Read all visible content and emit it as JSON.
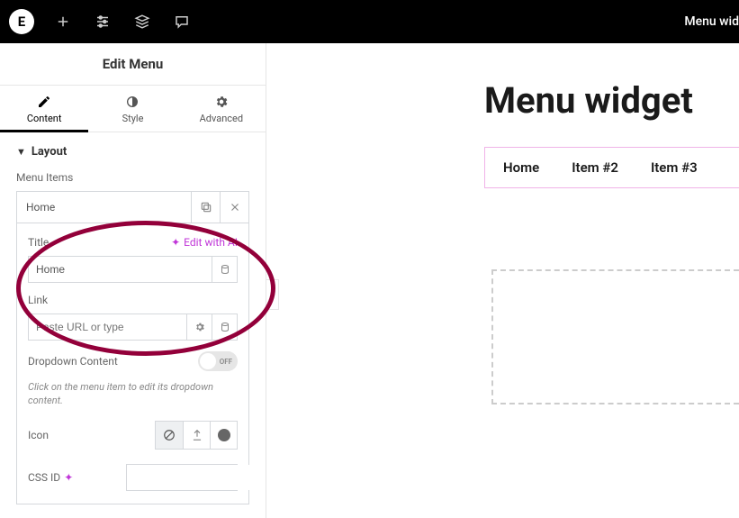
{
  "topbar": {
    "logo_letter": "E",
    "right_text": "Menu wid"
  },
  "panel": {
    "title": "Edit Menu",
    "tabs": {
      "content": "Content",
      "style": "Style",
      "advanced": "Advanced"
    },
    "section_layout": "Layout",
    "menu_items_label": "Menu Items",
    "item_label": "Home",
    "title_label": "Title",
    "edit_with_ai": "Edit with AI",
    "title_value": "Home",
    "link_label": "Link",
    "link_placeholder": "Paste URL or type",
    "dropdown_label": "Dropdown Content",
    "dropdown_off": "OFF",
    "dropdown_hint": "Click on the menu item to edit its dropdown content.",
    "icon_label": "Icon",
    "cssid_label": "CSS ID"
  },
  "canvas": {
    "heading": "Menu widget",
    "items": [
      "Home",
      "Item #2",
      "Item #3"
    ]
  }
}
